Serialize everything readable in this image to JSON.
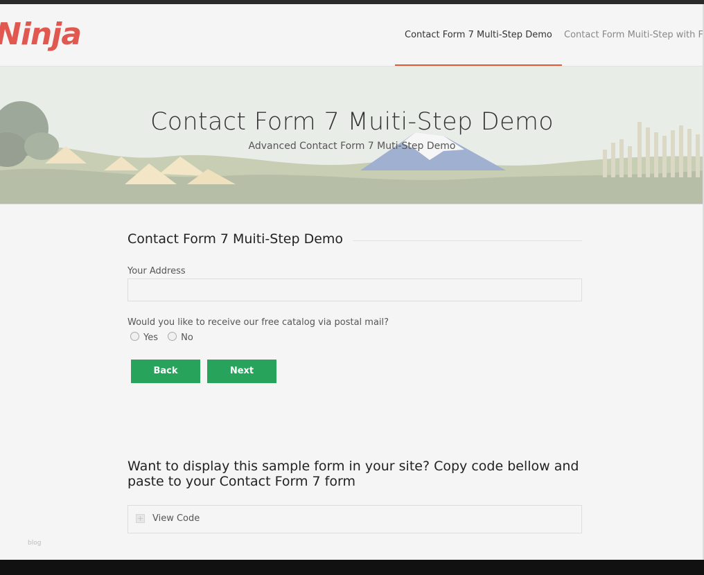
{
  "header": {
    "logo_text": "Ninja",
    "nav": [
      {
        "label": "Contact Form 7 Multi-Step Demo",
        "active": true
      },
      {
        "label": "Contact Form Muiti-Step with Fa",
        "active": false
      }
    ]
  },
  "hero": {
    "title": "Contact Form 7 Muiti-Step Demo",
    "subtitle": "Advanced Contact Form 7 Muti-Step Demo"
  },
  "form": {
    "title": "Contact Form 7 Muiti-Step Demo",
    "address_label": "Your Address",
    "address_value": "",
    "catalog_question": "Would you like to receive our free catalog via postal mail?",
    "options": [
      "Yes",
      "No"
    ],
    "back_label": "Back",
    "next_label": "Next"
  },
  "cta": {
    "line1": "Want to display this sample form in your site? Copy code bellow and",
    "line2": "paste to your Contact Form 7 form"
  },
  "accordion": {
    "label": "View Code"
  },
  "watermark": "blog",
  "colors": {
    "accent": "#e05a3a",
    "logo": "#e0584f",
    "button": "#27a35c",
    "footer": "#111111"
  }
}
